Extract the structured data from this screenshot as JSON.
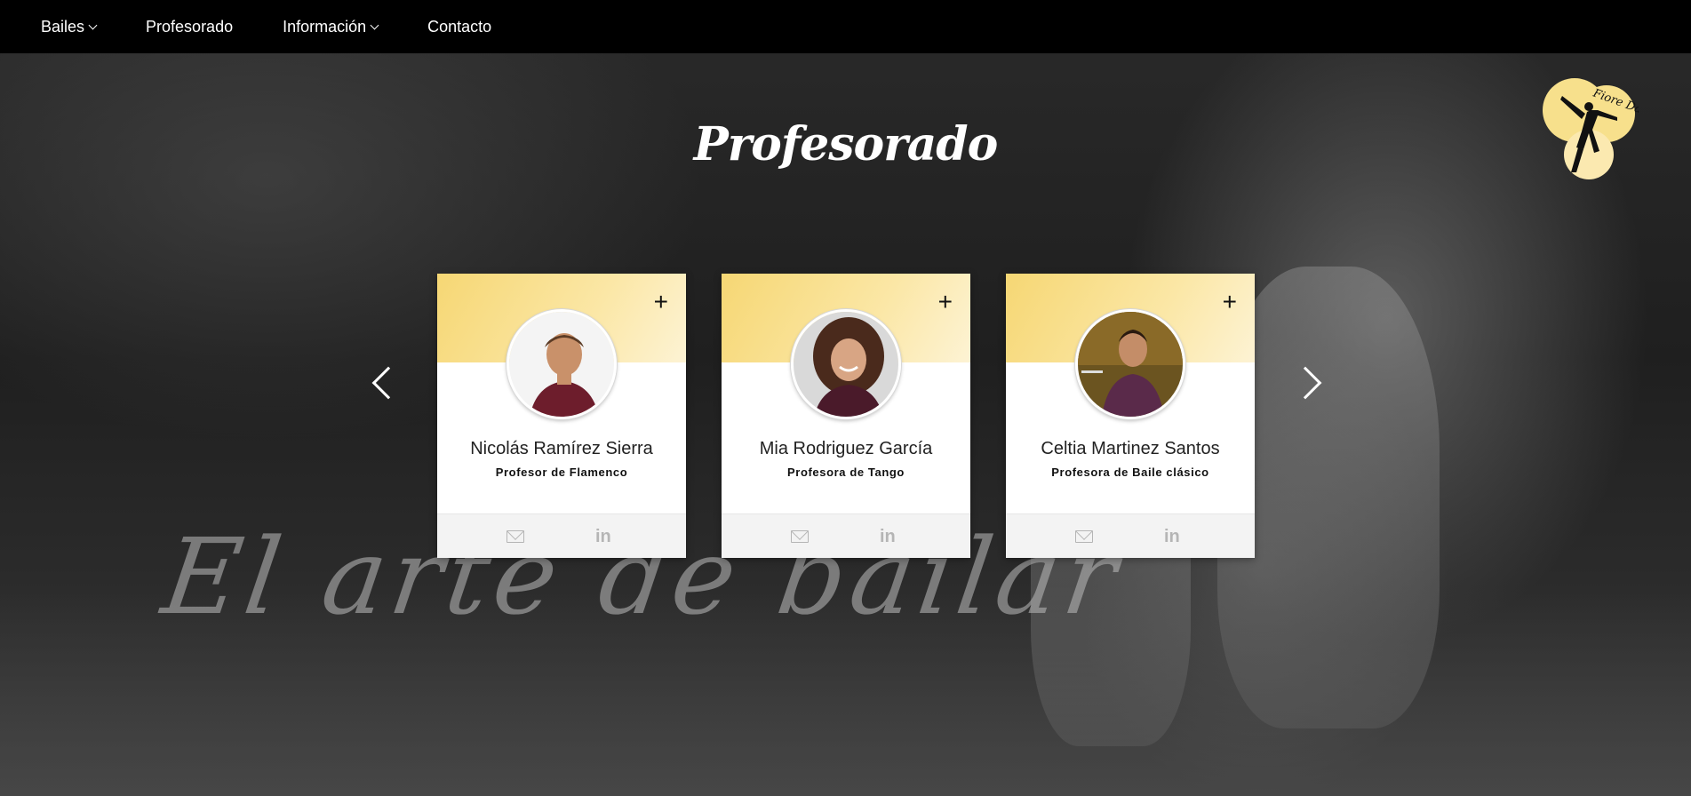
{
  "nav": {
    "items": [
      {
        "label": "Bailes",
        "has_dropdown": true
      },
      {
        "label": "Profesorado",
        "has_dropdown": false
      },
      {
        "label": "Información",
        "has_dropdown": true
      },
      {
        "label": "Contacto",
        "has_dropdown": false
      }
    ]
  },
  "page": {
    "title": "Profesorado",
    "watermark": "El arte de bailar"
  },
  "logo": {
    "text": "Fiore Dance",
    "accent": "#f7e08c"
  },
  "carousel": {
    "prev_icon": "chevron-left-icon",
    "next_icon": "chevron-right-icon",
    "cards": [
      {
        "name": "Nicolás Ramírez Sierra",
        "role": "Profesor de Flamenco",
        "expand": "+",
        "shirt": "#6d1d2c"
      },
      {
        "name": "Mia Rodriguez García",
        "role": "Profesora de Tango",
        "expand": "+",
        "shirt": "#4a1a2a"
      },
      {
        "name": "Celtia Martinez Santos",
        "role": "Profesora de Baile clásico",
        "expand": "+",
        "shirt": "#5a2a4a"
      }
    ]
  },
  "colors": {
    "nav_bg": "#000000",
    "card_gradient_start": "#f6d774",
    "card_gradient_end": "#fdf3d4",
    "footer_icon": "#b5b5b5"
  }
}
